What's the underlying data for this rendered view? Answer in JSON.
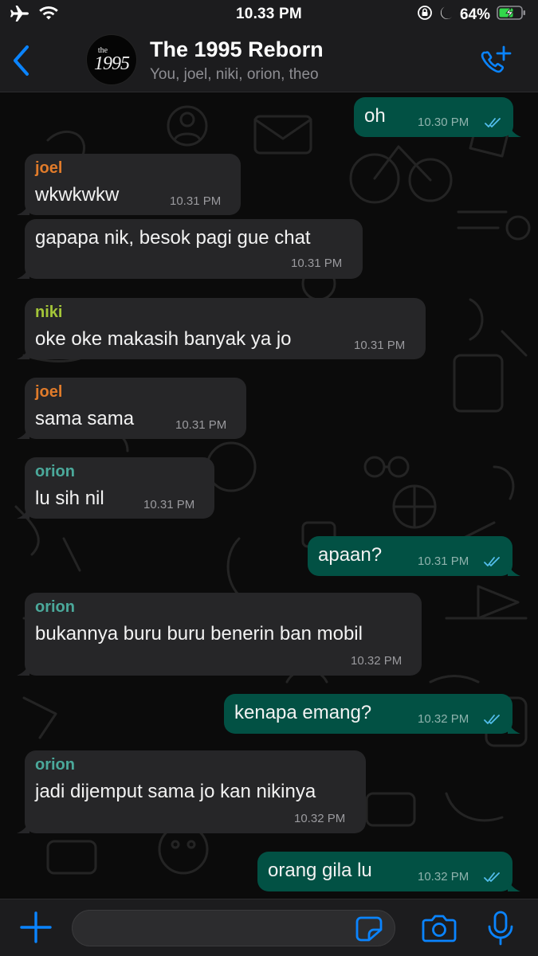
{
  "status_bar": {
    "time": "10.33 PM",
    "battery": "64%"
  },
  "header": {
    "title": "The 1995 Reborn",
    "subtitle": "You, joel, niki, orion, theo",
    "avatar_small": "the",
    "avatar_big": "1995"
  },
  "colors": {
    "outgoing": "#025144",
    "incoming": "#262628",
    "accent": "#0a84ff",
    "joel": "#e07b2a",
    "niki": "#a4c639",
    "orion": "#4ba99b"
  },
  "messages": [
    {
      "text": "oh",
      "time": "10.30 PM",
      "sender": "",
      "direction": "out"
    },
    {
      "text": "wkwkwkw",
      "time": "10.31 PM",
      "sender": "joel",
      "direction": "in"
    },
    {
      "text": "gapapa nik, besok pagi gue chat",
      "time": "10.31 PM",
      "sender": "",
      "direction": "in"
    },
    {
      "text": "oke oke makasih banyak ya jo",
      "time": "10.31 PM",
      "sender": "niki",
      "direction": "in"
    },
    {
      "text": "sama sama",
      "time": "10.31 PM",
      "sender": "joel",
      "direction": "in"
    },
    {
      "text": "lu sih nil",
      "time": "10.31 PM",
      "sender": "orion",
      "direction": "in"
    },
    {
      "text": "apaan?",
      "time": "10.31 PM",
      "sender": "",
      "direction": "out"
    },
    {
      "text": "bukannya buru buru benerin ban mobil",
      "time": "10.32 PM",
      "sender": "orion",
      "direction": "in"
    },
    {
      "text": "kenapa emang?",
      "time": "10.32 PM",
      "sender": "",
      "direction": "out"
    },
    {
      "text": "jadi dijemput sama jo kan nikinya",
      "time": "10.32 PM",
      "sender": "orion",
      "direction": "in"
    },
    {
      "text": "orang gila lu",
      "time": "10.32 PM",
      "sender": "",
      "direction": "out"
    }
  ],
  "input": {
    "value": "",
    "placeholder": ""
  }
}
